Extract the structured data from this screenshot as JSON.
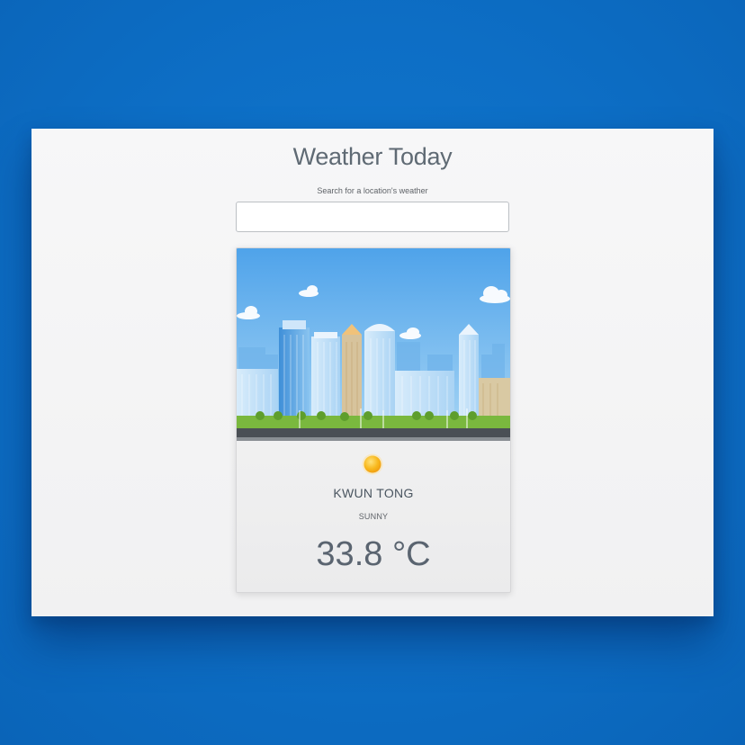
{
  "app": {
    "title": "Weather Today"
  },
  "search": {
    "label": "Search for a location's weather",
    "value": "",
    "placeholder": ""
  },
  "weather_card": {
    "image": "city-skyline-illustration",
    "icon": "sun-icon",
    "location": "KWUN TONG",
    "condition": "SUNNY",
    "temperature": "33.8 °C"
  },
  "colors": {
    "background": "#0d6ec5",
    "panel": "#f4f4f5",
    "text": "#5f6a74",
    "sky": "#5aaaea",
    "sun": "#f5b21a"
  }
}
